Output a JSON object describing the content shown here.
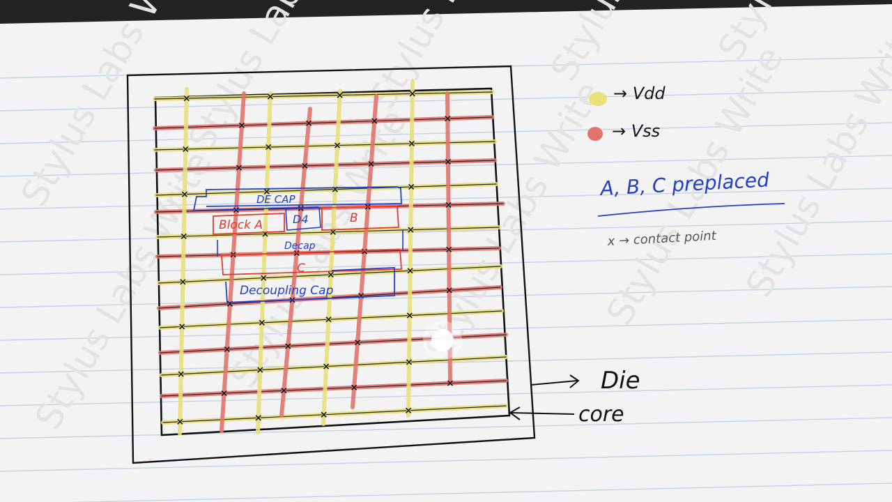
{
  "legend": {
    "vdd_label": "→ Vdd",
    "vss_label": "→ Vss",
    "preplaced_note": "A, B, C preplaced",
    "contact_note": "x → contact point"
  },
  "blocks": {
    "decap_top": "DE CAP",
    "block_a": "Block A",
    "d4": "D4",
    "block_b": "B",
    "decap_mid": "Decap",
    "block_c": "C",
    "decoupling_cap": "Decoupling Cap"
  },
  "pointers": {
    "die": "Die",
    "core": "core"
  },
  "watermark": "Stylus Labs Write",
  "colors": {
    "vdd": "#e8e07a",
    "vss": "#e2746e",
    "ink_blue": "#1f3fc8",
    "ink_red": "#e23a2a",
    "ink_black": "#151515",
    "paper": "#f4f4f4",
    "rule": "#c9d3e6"
  }
}
